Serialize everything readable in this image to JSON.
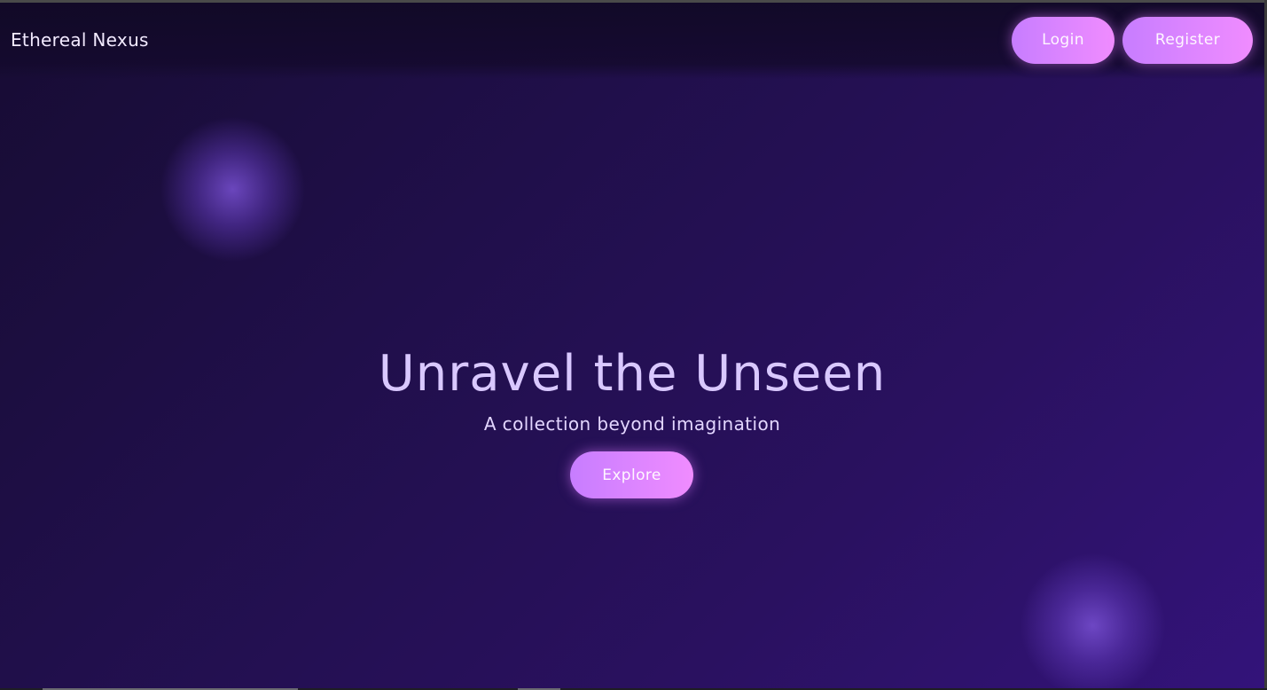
{
  "navbar": {
    "brand": "Ethereal Nexus",
    "login_label": "Login",
    "register_label": "Register"
  },
  "hero": {
    "title": "Unravel the Unseen",
    "subtitle": "A collection beyond imagination",
    "cta_label": "Explore"
  },
  "colors": {
    "background_start": "#170c33",
    "background_end": "#33137a",
    "button_gradient_start": "#c77dff",
    "button_gradient_end": "#f08cff",
    "title_color": "#d9c8ff"
  }
}
